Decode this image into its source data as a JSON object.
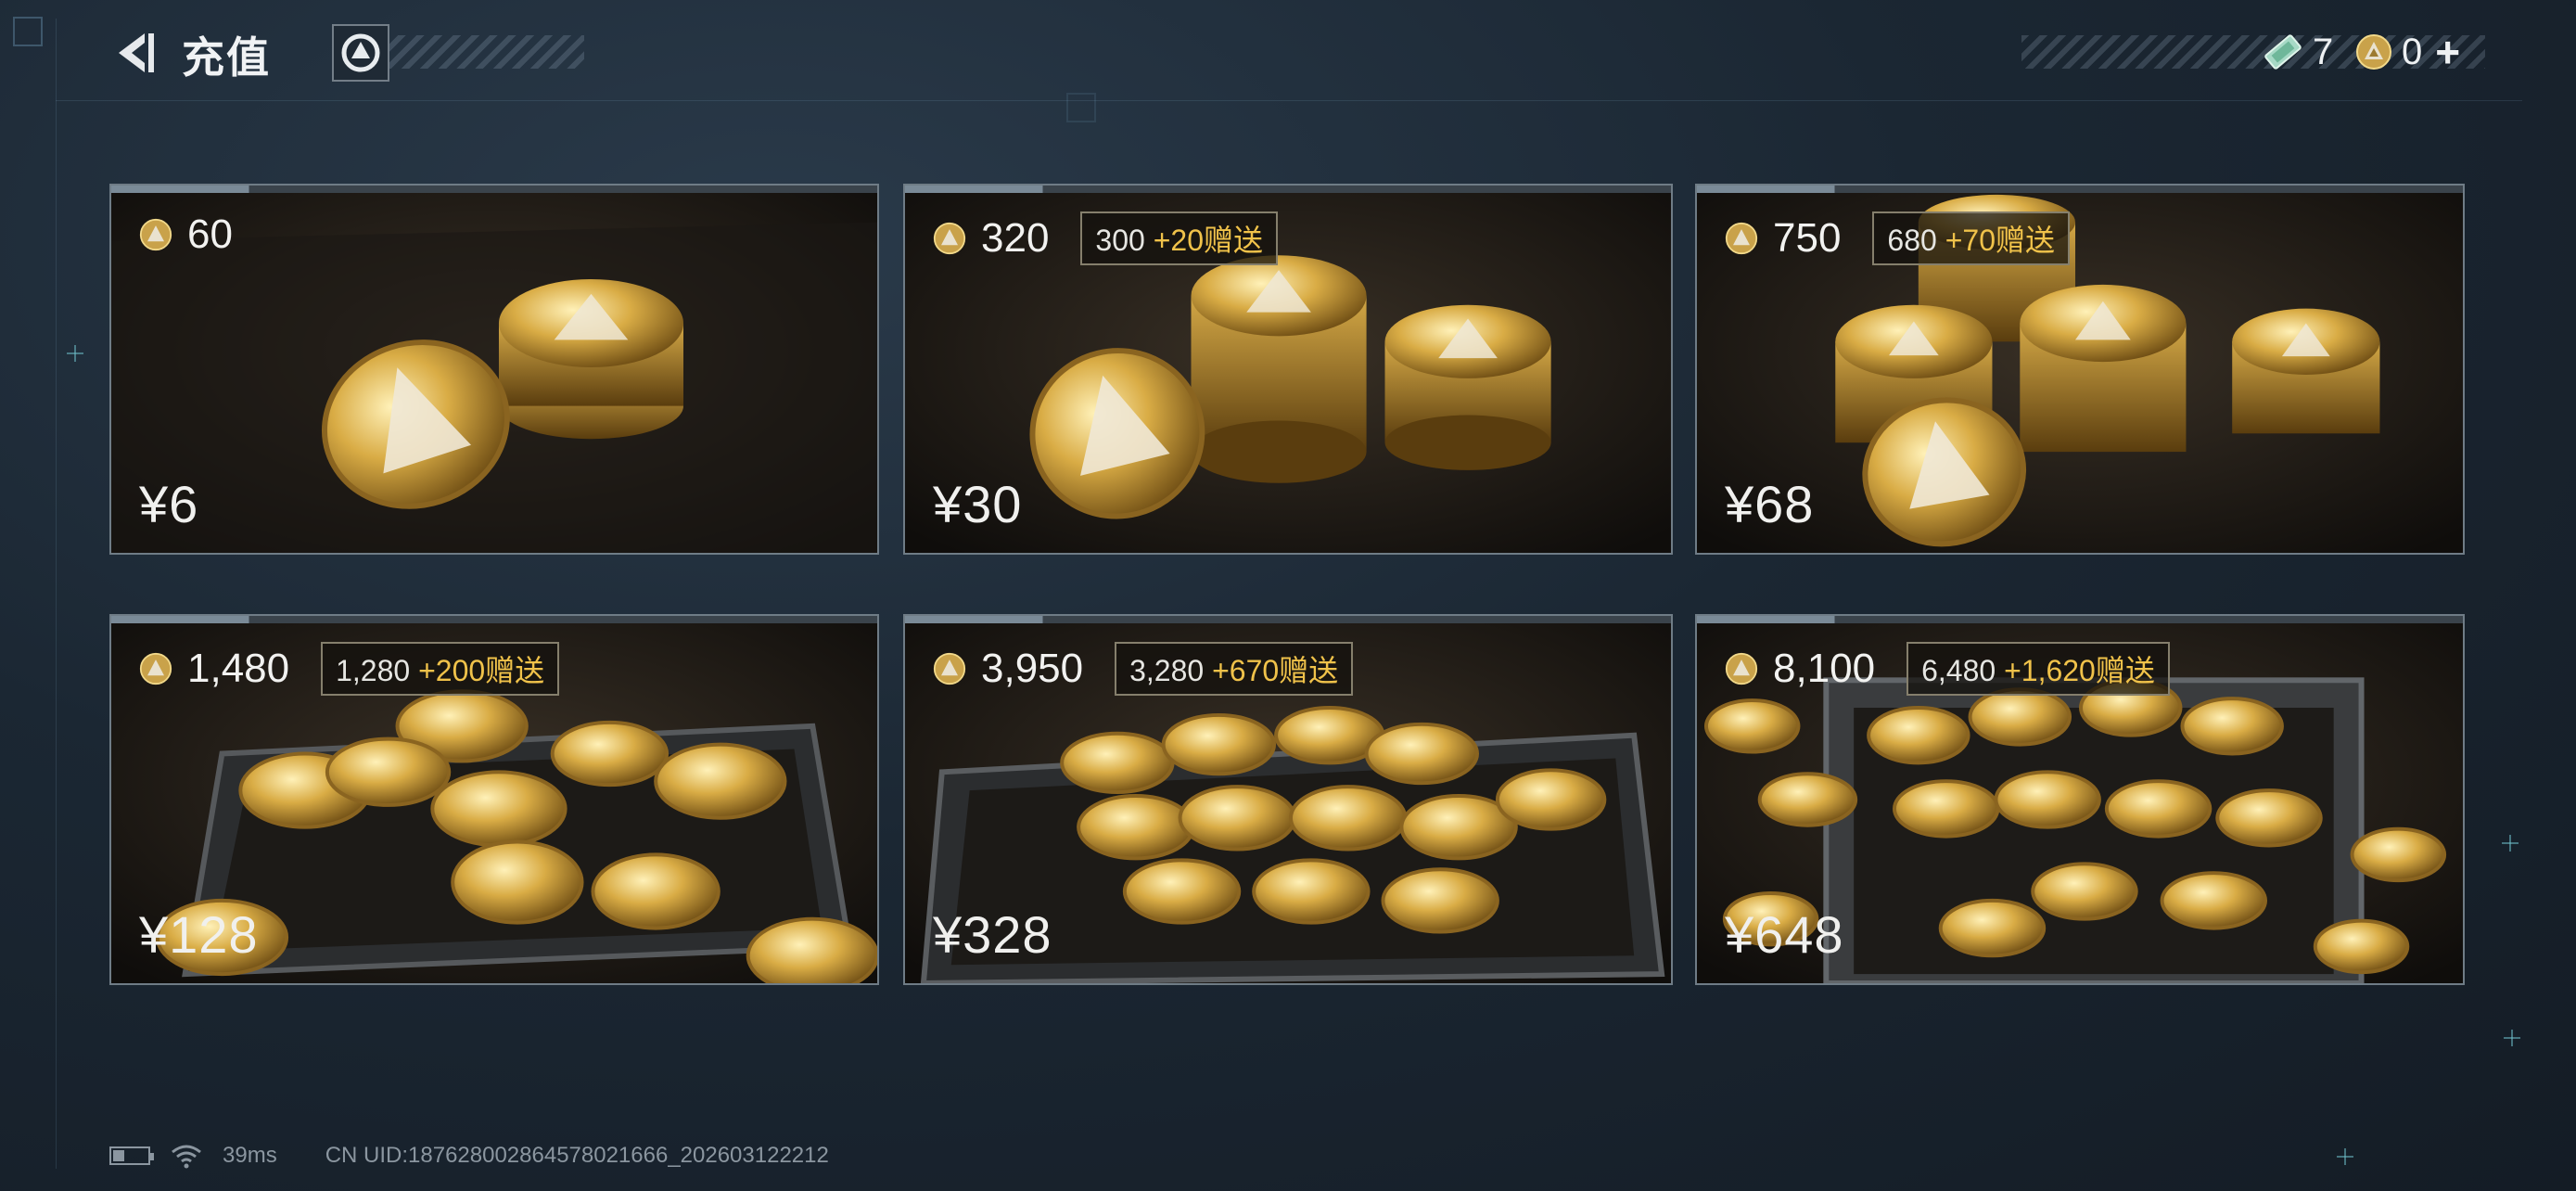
{
  "header": {
    "title": "充值",
    "ticket_count": "7",
    "coin_count": "0",
    "add_symbol": "+"
  },
  "colors": {
    "bonus_highlight": "#f0c24a",
    "card_border": "#6f7c86",
    "background": "#1b2733"
  },
  "packages": [
    {
      "amount": "60",
      "base": "",
      "bonus": "",
      "price": "¥6"
    },
    {
      "amount": "320",
      "base": "300",
      "bonus": "+20赠送",
      "price": "¥30"
    },
    {
      "amount": "750",
      "base": "680",
      "bonus": "+70赠送",
      "price": "¥68"
    },
    {
      "amount": "1,480",
      "base": "1,280",
      "bonus": "+200赠送",
      "price": "¥128"
    },
    {
      "amount": "3,950",
      "base": "3,280",
      "bonus": "+670赠送",
      "price": "¥328"
    },
    {
      "amount": "8,100",
      "base": "6,480",
      "bonus": "+1,620赠送",
      "price": "¥648"
    }
  ],
  "status": {
    "ping": "39ms",
    "uid": "CN UID:1876280028645780216​66_202603122212"
  },
  "icons": {
    "back": "back-arrow-icon",
    "logo": "delta-logo-icon",
    "ticket": "ticket-icon",
    "coin": "delta-coin-icon",
    "wifi": "wifi-icon",
    "battery": "battery-icon"
  }
}
